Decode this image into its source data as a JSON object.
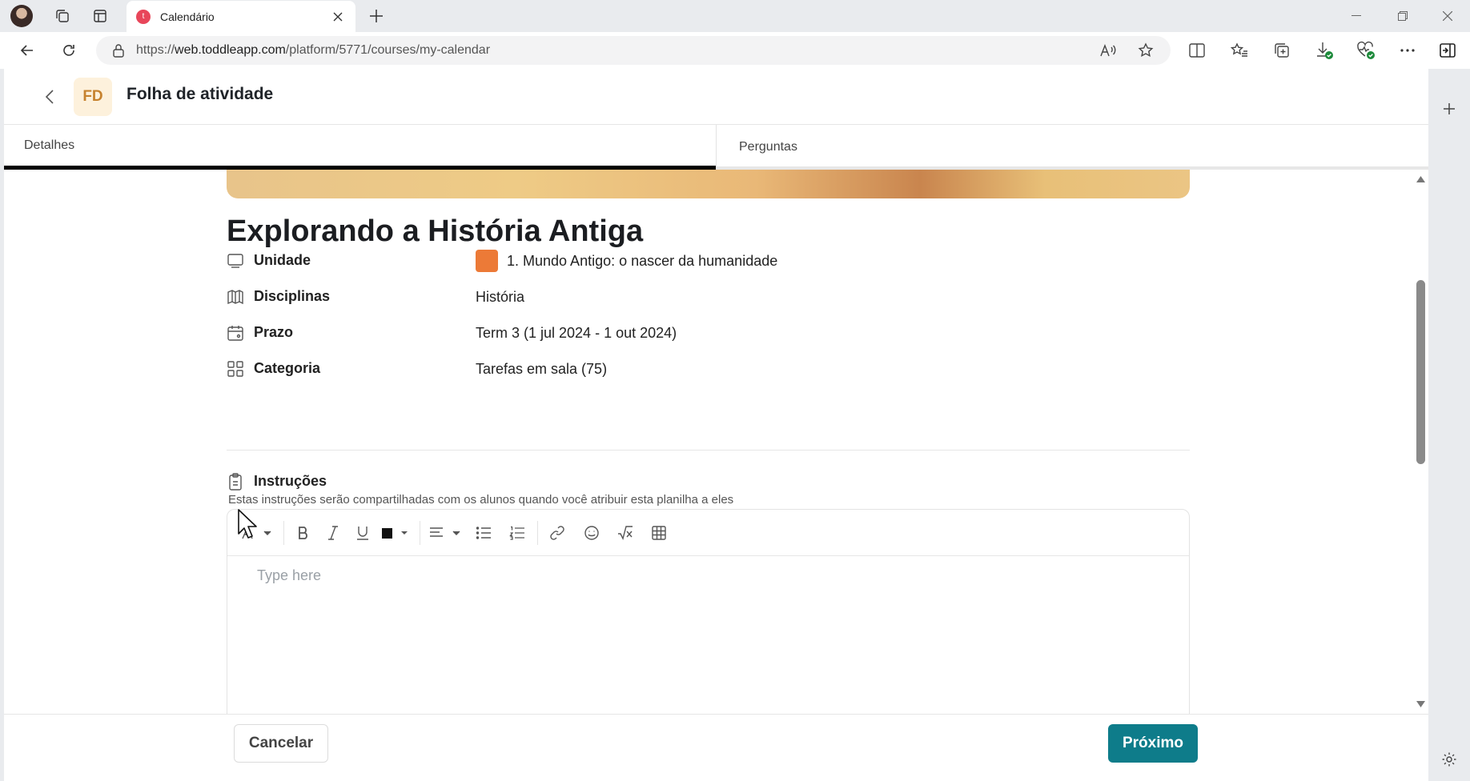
{
  "browser": {
    "tab_title": "Calendário",
    "url_scheme": "https://",
    "url_host": "web.toddleapp.com",
    "url_path": "/platform/5771/courses/my-calendar"
  },
  "header": {
    "badge": "FD",
    "title": "Folha de atividade"
  },
  "tabs": [
    {
      "label": "Detalhes",
      "active": true
    },
    {
      "label": "Perguntas",
      "active": false
    }
  ],
  "page": {
    "title": "Explorando a História Antiga",
    "meta": [
      {
        "label": "Unidade",
        "value": "1. Mundo Antigo: o nascer da humanidade",
        "icon": "unit-icon"
      },
      {
        "label": "Disciplinas",
        "value": "História",
        "icon": "book-icon"
      },
      {
        "label": "Prazo",
        "value": "Term 3 (1 jul 2024 - 1 out 2024)",
        "icon": "calendar-icon"
      },
      {
        "label": "Categoria",
        "value": "Tarefas em sala (75)",
        "icon": "grid-icon"
      }
    ],
    "unit_color": "#ec7a37",
    "instructions": {
      "label": "Instruções",
      "subtitle": "Estas instruções serão compartilhadas com os alunos quando você atribuir esta planilha a eles",
      "placeholder": "Type here"
    }
  },
  "footer": {
    "cancel_label": "Cancelar",
    "next_label": "Próximo",
    "accent": "#0e7c8a"
  }
}
